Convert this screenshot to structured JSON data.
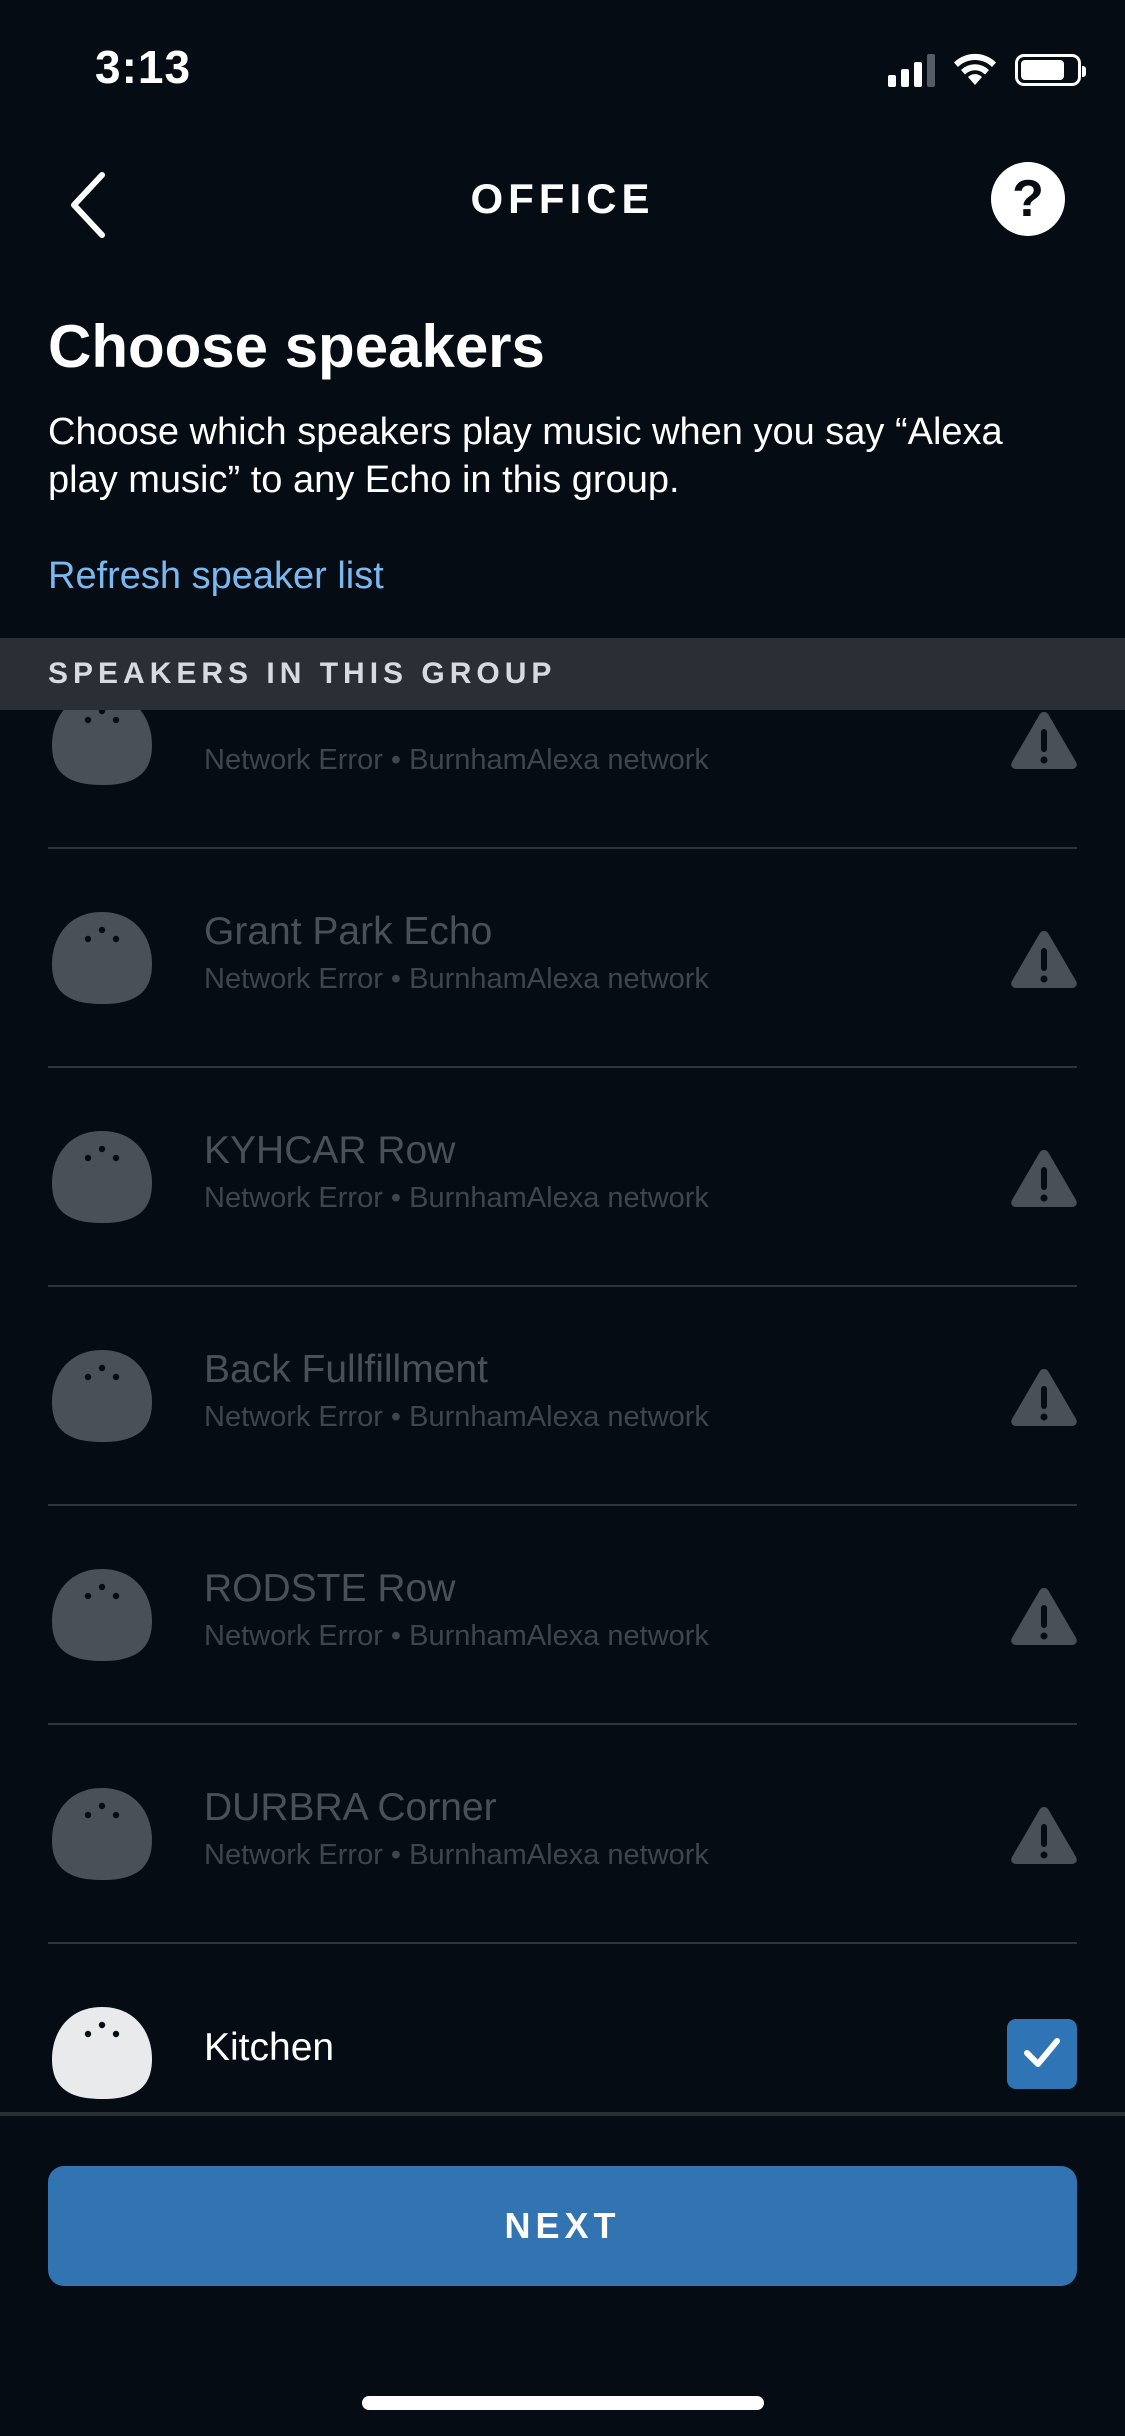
{
  "status_bar": {
    "time": "3:13"
  },
  "nav": {
    "title": "OFFICE",
    "help_label": "?"
  },
  "header": {
    "title": "Choose speakers",
    "description": "Choose which speakers play music when you say “Alexa play music” to any Echo in this group.",
    "refresh_label": "Refresh speaker list"
  },
  "section": {
    "label": "SPEAKERS IN THIS GROUP"
  },
  "speakers": [
    {
      "name": "",
      "status": "Network Error • BurnhamAlexa network",
      "state": "error"
    },
    {
      "name": "Grant Park Echo",
      "status": "Network Error • BurnhamAlexa network",
      "state": "error"
    },
    {
      "name": "KYHCAR Row",
      "status": "Network Error • BurnhamAlexa network",
      "state": "error"
    },
    {
      "name": "Back Fullfillment",
      "status": "Network Error • BurnhamAlexa network",
      "state": "error"
    },
    {
      "name": "RODSTE Row",
      "status": "Network Error • BurnhamAlexa network",
      "state": "error"
    },
    {
      "name": "DURBRA Corner",
      "status": "Network Error • BurnhamAlexa network",
      "state": "error"
    },
    {
      "name": "Kitchen",
      "status": "",
      "state": "selected"
    }
  ],
  "footer": {
    "next_label": "NEXT"
  },
  "colors": {
    "background": "#050c14",
    "accent_blue": "#3274b1",
    "link_blue": "#7ab8f0",
    "disabled_gray": "#4a5058"
  }
}
